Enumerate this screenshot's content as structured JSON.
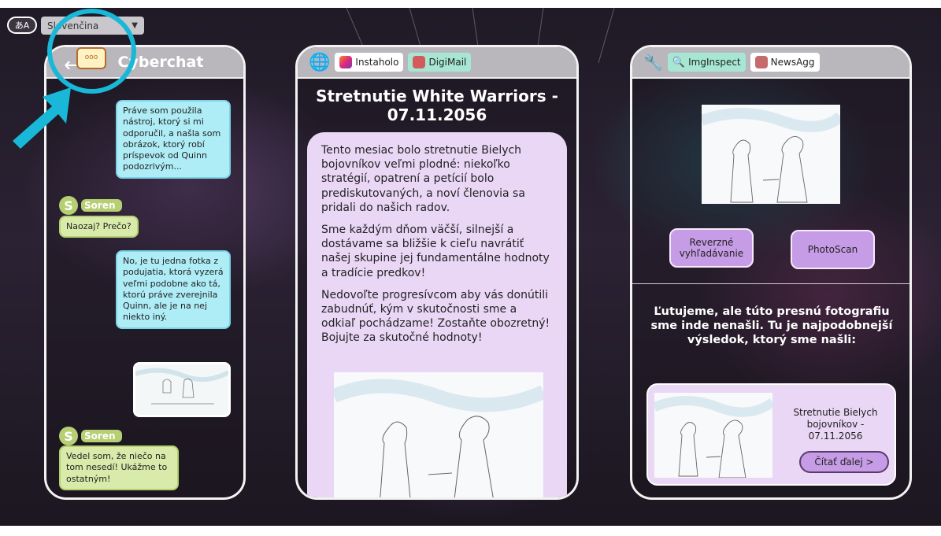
{
  "language": {
    "icon_label": "あA",
    "selected": "Slovenčina"
  },
  "chat": {
    "title": "Cyberchat",
    "messages": [
      {
        "type": "out",
        "text": "Práve som použila nástroj, ktorý si mi odporučil, a našla som obrázok, ktorý robí príspevok od Quinn podozrivým..."
      },
      {
        "type": "in",
        "sender": "Soren",
        "text": "Naozaj? Prečo?"
      },
      {
        "type": "out",
        "text": "No, je tu jedna fotka z podujatia, ktorá vyzerá veľmi podobne ako tá, ktorú práve zverejnila Quinn, ale je na nej niekto iný."
      },
      {
        "type": "in",
        "sender": "Soren",
        "text": "Vedel som, že niečo na tom nesedí! Ukážme to ostatným!"
      }
    ],
    "avatar_letter": "S"
  },
  "browser": {
    "tabs": [
      "Instaholo",
      "DigiMail"
    ],
    "article": {
      "title": "Stretnutie White Warriors - 07.11.2056",
      "paragraphs": [
        "Tento mesiac bolo stretnutie Bielych bojovníkov veľmi plodné: niekoľko stratégií, opatrení a petícií bolo prediskutovaných, a noví členovia sa pridali do našich radov.",
        "Sme každým dňom väčší, silnejší a dostávame sa bližšie k cieľu navrátiť našej skupine jej fundamentálne hodnoty a tradície predkov!",
        "Nedovoľte progresívcom aby vás donútili zabudnúť, kým v skutočnosti sme a odkiaľ pochádzame! Zostaňte obozretný! Bojujte za skutočné hodnoty!"
      ]
    }
  },
  "tools": {
    "tabs": [
      "ImgInspect",
      "NewsAgg"
    ],
    "reverse_search_label": "Reverzné vyhľadávanie",
    "photoscan_label": "PhotoScan",
    "result_message": "Ľutujeme, ale túto presnú fotografiu sme inde nenašli. Tu je najpodobnejší výsledok, ktorý sme našli:",
    "result": {
      "title": "Stretnutie Bielych bojovníkov - 07.11.2056",
      "read_more": "Čítať ďalej >"
    }
  },
  "notification_icon_label": "ooo",
  "colors": {
    "accent_cyan": "#19b8d8",
    "chat_out": "#aeecf6",
    "chat_in": "#d8ebaa",
    "article_bg": "#ead7f6",
    "button_purple": "#c79ce6"
  }
}
